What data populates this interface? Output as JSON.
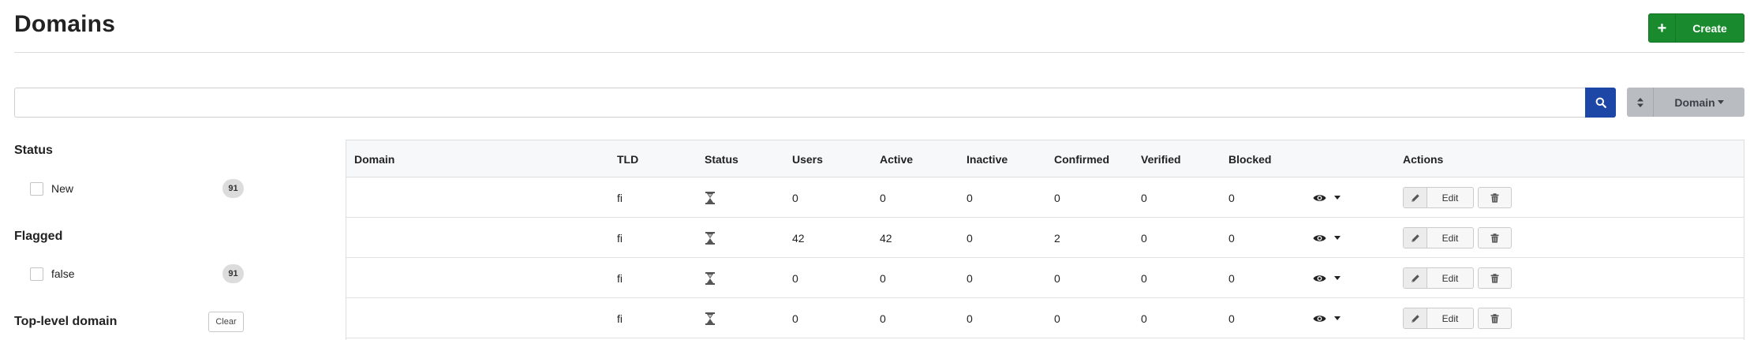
{
  "header": {
    "title": "Domains",
    "create_label": "Create",
    "create_icon": "plus-icon"
  },
  "search": {
    "value": "",
    "placeholder": "",
    "button_icon": "search-icon"
  },
  "sort": {
    "icon": "sort-icon",
    "field": "Domain"
  },
  "facets": {
    "status": {
      "heading": "Status",
      "option": "New",
      "count": "91"
    },
    "flagged": {
      "heading": "Flagged",
      "option": "false",
      "count": "91"
    },
    "tld": {
      "heading": "Top-level domain",
      "clear_label": "Clear"
    }
  },
  "table": {
    "columns": [
      "Domain",
      "TLD",
      "Status",
      "Users",
      "Active",
      "Inactive",
      "Confirmed",
      "Verified",
      "Blocked",
      "",
      "Actions"
    ],
    "rows": [
      {
        "domain": "",
        "tld": "fi",
        "status_icon": "hourglass-icon",
        "users": "0",
        "active": "0",
        "inactive": "0",
        "confirmed": "0",
        "verified": "0",
        "blocked": "0"
      },
      {
        "domain": "",
        "tld": "fi",
        "status_icon": "hourglass-icon",
        "users": "42",
        "active": "42",
        "inactive": "0",
        "confirmed": "2",
        "verified": "0",
        "blocked": "0"
      },
      {
        "domain": "",
        "tld": "fi",
        "status_icon": "hourglass-icon",
        "users": "0",
        "active": "0",
        "inactive": "0",
        "confirmed": "0",
        "verified": "0",
        "blocked": "0"
      },
      {
        "domain": "",
        "tld": "fi",
        "status_icon": "hourglass-icon",
        "users": "0",
        "active": "0",
        "inactive": "0",
        "confirmed": "0",
        "verified": "0",
        "blocked": "0"
      }
    ],
    "row_actions": {
      "edit_label": "Edit",
      "edit_icon": "pencil-icon",
      "delete_icon": "trash-icon",
      "preview_icon": "eye-icon"
    }
  },
  "colors": {
    "create_button": "#1a8a2e",
    "search_button": "#1d47a6",
    "sort_button": "#b9bcc1",
    "table_header": "#f7f8fa"
  }
}
